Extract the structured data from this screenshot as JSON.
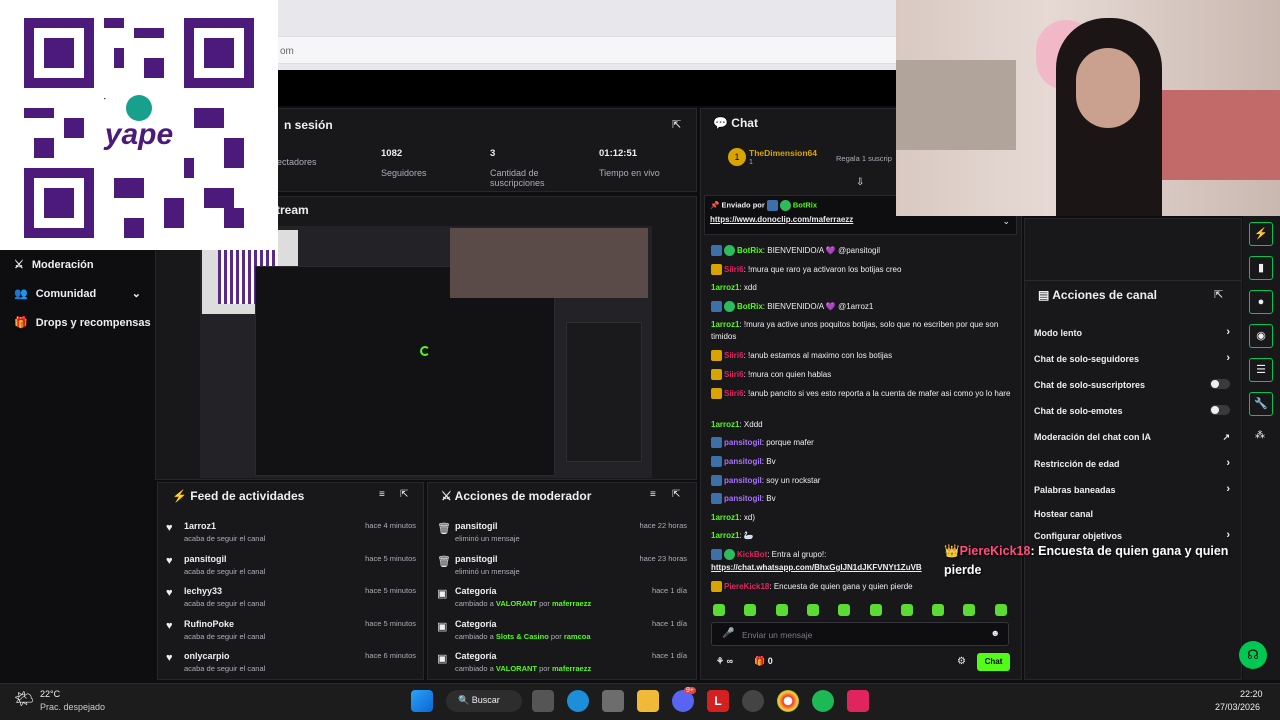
{
  "browser": {
    "url_fragment": "om"
  },
  "stream_info": {
    "title_fragment": "n sesión",
    "stats": [
      {
        "value": "",
        "label": "pectadores"
      },
      {
        "value": "1082",
        "label": "Seguidores"
      },
      {
        "value": "3",
        "label": "Cantidad de suscripciones"
      },
      {
        "value": "01:12:51",
        "label": "Tiempo en vivo"
      }
    ]
  },
  "preview": {
    "title_fragment": "tream"
  },
  "sidebar": {
    "items": [
      {
        "label": "Moderación",
        "icon": "sword-icon"
      },
      {
        "label": "Comunidad",
        "icon": "community-icon"
      },
      {
        "label": "Drops y recompensas",
        "icon": "gift-icon"
      }
    ]
  },
  "feed": {
    "title": "Feed de actividades",
    "items": [
      {
        "name": "1arroz1",
        "desc": "acaba de seguir el canal",
        "time": "hace 4 minutos"
      },
      {
        "name": "pansitogil",
        "desc": "acaba de seguir el canal",
        "time": "hace 5 minutos"
      },
      {
        "name": "lechyy33",
        "desc": "acaba de seguir el canal",
        "time": "hace 5 minutos"
      },
      {
        "name": "RufinoPoke",
        "desc": "acaba de seguir el canal",
        "time": "hace 5 minutos"
      },
      {
        "name": "onlycarpio",
        "desc": "acaba de seguir el canal",
        "time": "hace 6 minutos"
      }
    ]
  },
  "mod_actions": {
    "title": "Acciones de moderador",
    "items": [
      {
        "name": "pansitogil",
        "desc": "eliminó un mensaje",
        "time": "hace 22 horas"
      },
      {
        "name": "pansitogil",
        "desc": "eliminó un mensaje",
        "time": "hace 23 horas"
      },
      {
        "name": "Categoría",
        "desc_prefix": "cambiado a",
        "target": "VALORANT",
        "by": "por",
        "user": "maferraezz",
        "time": "hace 1 día"
      },
      {
        "name": "Categoría",
        "desc_prefix": "cambiado a",
        "target": "Slots & Casino",
        "by": "por",
        "user": "ramcoa",
        "time": "hace 1 día"
      },
      {
        "name": "Categoría",
        "desc_prefix": "cambiado a",
        "target": "VALORANT",
        "by": "por",
        "user": "maferraezz",
        "time": "hace 1 día"
      }
    ]
  },
  "chat": {
    "title": "Chat",
    "gifter": "TheDimension64",
    "gifter_count": "1",
    "gift_text": "Regala 1 suscrip",
    "pinned_label": "Enviado por",
    "pinned_user": "BotRix",
    "pinned_link": "https://www.donoclip.com/maferraezz",
    "messages": [
      {
        "user": "BotRix",
        "text": ": BIENVENIDO/A 💜 @pansitogil"
      },
      {
        "user": "Siiri6",
        "text": ": !mura que raro ya activaron los botijas creo"
      },
      {
        "user": "1arroz1",
        "text": ": xdd"
      },
      {
        "user": "BotRix",
        "text": ": BIENVENIDO/A 💜 @1arroz1"
      },
      {
        "user": "1arroz1",
        "text": ": !mura ya active unos poquitos botijas, solo que no escriben por que son timidos"
      },
      {
        "user": "Siiri6",
        "text": ": !anub estamos al maximo con los botijas"
      },
      {
        "user": "Siiri6",
        "text": ": !mura con quien hablas"
      },
      {
        "user": "Siiri6",
        "text": ": !anub pancito si ves esto reporta a la cuenta de mafer asi como yo lo hare"
      },
      {
        "user": "1arroz1",
        "text": ": Xddd"
      },
      {
        "user": "pansitogil",
        "text": ": porque mafer"
      },
      {
        "user": "pansitogil",
        "text": ": Bv"
      },
      {
        "user": "pansitogil",
        "text": ": soy un rockstar"
      },
      {
        "user": "pansitogil",
        "text": ": Bv"
      },
      {
        "user": "1arroz1",
        "text": ": xd)"
      },
      {
        "user": "1arroz1",
        "text": ": 🦢"
      },
      {
        "user": "KickBot",
        "text": ": Entra al grupo!:"
      },
      {
        "user": "",
        "text": "https://chat.whatsapp.com/BhxGgIJN1dJKFVNYt1ZuVB"
      },
      {
        "user": "PiereKick18",
        "text": ": Encuesta de quien gana y quien pierde"
      }
    ],
    "input_placeholder": "Enviar un mensaje",
    "points": "∞",
    "gifts": "0",
    "send_label": "Chat"
  },
  "channel_actions": {
    "title": "Acciones de canal",
    "items": [
      {
        "label": "Modo lento",
        "ctl": "chevron"
      },
      {
        "label": "Chat de solo-seguidores",
        "ctl": "chevron"
      },
      {
        "label": "Chat de solo-suscriptores",
        "ctl": "toggle"
      },
      {
        "label": "Chat de solo-emotes",
        "ctl": "toggle"
      },
      {
        "label": "Moderación del chat con IA",
        "ctl": "external"
      },
      {
        "label": "Restricción de edad",
        "ctl": "chevron"
      },
      {
        "label": "Palabras baneadas",
        "ctl": "chevron"
      },
      {
        "label": "Hostear canal",
        "ctl": "none"
      },
      {
        "label": "Configurar objetivos",
        "ctl": "chevron"
      }
    ]
  },
  "overlay": {
    "user": "PiereKick18",
    "message": "Encuesta de quien gana y quien pierde"
  },
  "taskbar": {
    "temp": "22°C",
    "weather": "Prac. despejado",
    "search": "Buscar",
    "time": "22:20",
    "date": "27/03/2026",
    "notif_badge": "9+"
  },
  "colors": {
    "accent": "#53fc18",
    "bg": "#0e0e10",
    "panel": "#18181b",
    "qr_purple": "#4b1a7a"
  }
}
